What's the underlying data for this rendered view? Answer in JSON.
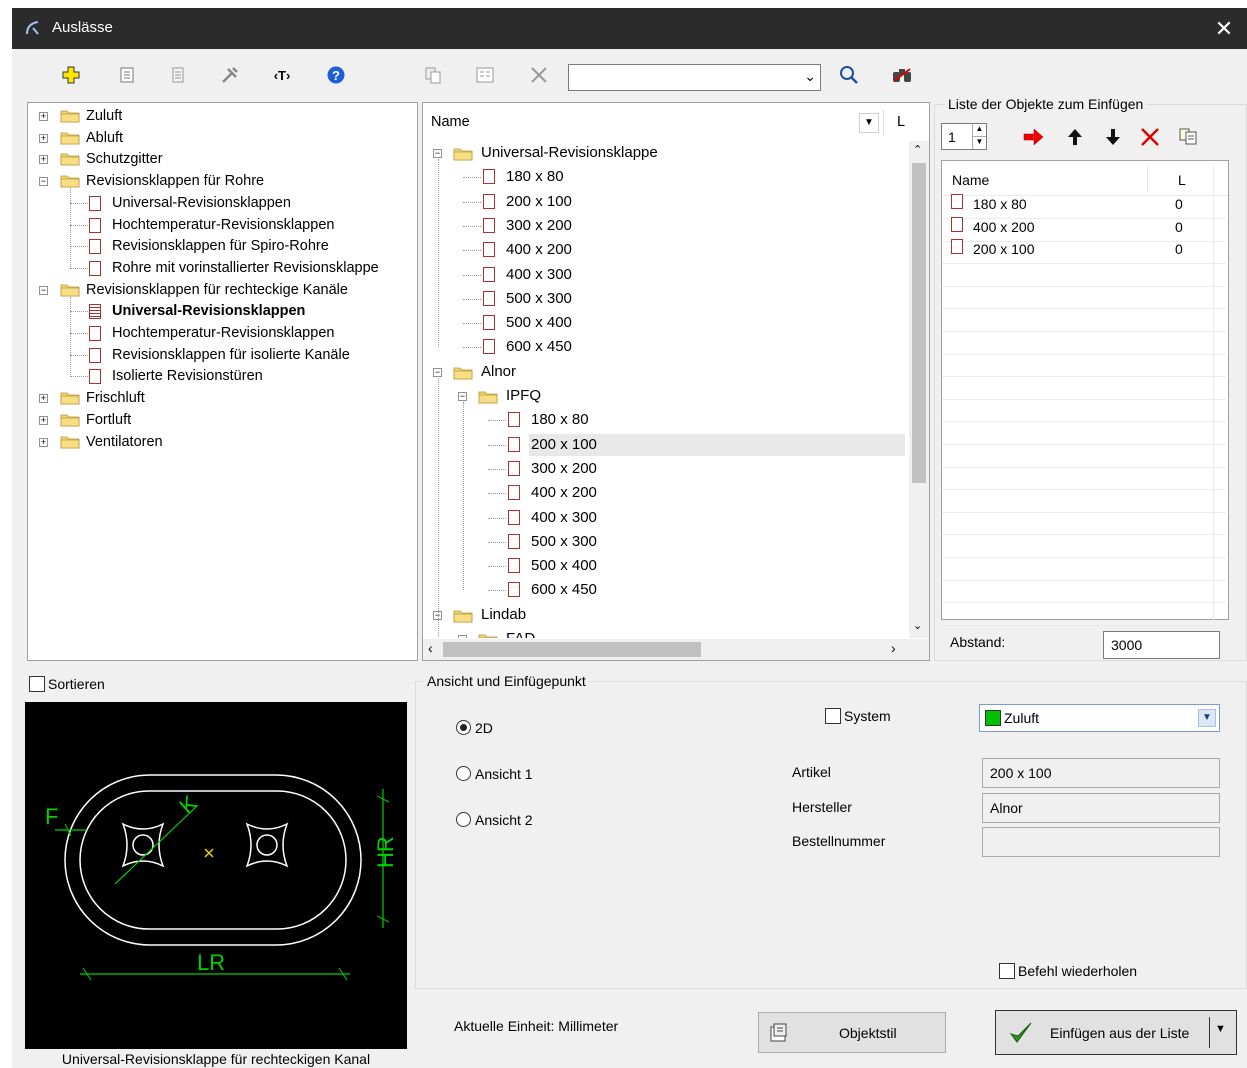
{
  "window": {
    "title": "Auslässe",
    "close": "✕"
  },
  "toolbar": {
    "search_value": "",
    "icons": [
      "add-icon",
      "properties-icon",
      "document-icon",
      "tools-icon",
      "text-tag-icon",
      "help-icon",
      "copy-icon",
      "form-icon",
      "delete-icon",
      "search-icon",
      "binoculars-icon"
    ]
  },
  "left_tree": {
    "items": [
      {
        "label": "Zuluft",
        "level": 0,
        "type": "folder",
        "expander": "+"
      },
      {
        "label": "Abluft",
        "level": 0,
        "type": "folder",
        "expander": "+"
      },
      {
        "label": "Schutzgitter",
        "level": 0,
        "type": "folder",
        "expander": "+"
      },
      {
        "label": "Revisionsklappen für Rohre",
        "level": 0,
        "type": "folder",
        "expander": "−"
      },
      {
        "label": "Universal-Revisionsklappen",
        "level": 1,
        "type": "item"
      },
      {
        "label": "Hochtemperatur-Revisionsklappen",
        "level": 1,
        "type": "item"
      },
      {
        "label": "Revisionsklappen für Spiro-Rohre",
        "level": 1,
        "type": "item"
      },
      {
        "label": "Rohre mit vorinstallierter Revisionsklappe",
        "level": 1,
        "type": "item"
      },
      {
        "label": "Revisionsklappen für rechteckige Kanäle",
        "level": 0,
        "type": "folder",
        "expander": "−"
      },
      {
        "label": "Universal-Revisionsklappen",
        "level": 1,
        "type": "item",
        "selected": true
      },
      {
        "label": "Hochtemperatur-Revisionsklappen",
        "level": 1,
        "type": "item"
      },
      {
        "label": "Revisionsklappen für isolierte Kanäle",
        "level": 1,
        "type": "item"
      },
      {
        "label": "Isolierte Revisionstüren",
        "level": 1,
        "type": "item"
      },
      {
        "label": "Frischluft",
        "level": 0,
        "type": "folder",
        "expander": "+"
      },
      {
        "label": "Fortluft",
        "level": 0,
        "type": "folder",
        "expander": "+"
      },
      {
        "label": "Ventilatoren",
        "level": 0,
        "type": "folder",
        "expander": "+"
      }
    ]
  },
  "middle_tree": {
    "col_name": "Name",
    "col_l": "L",
    "items": [
      {
        "label": "Universal-Revisionsklappe",
        "level": 0,
        "type": "folder"
      },
      {
        "label": "180 x 80",
        "level": 1,
        "type": "item"
      },
      {
        "label": "200 x 100",
        "level": 1,
        "type": "item"
      },
      {
        "label": "300 x 200",
        "level": 1,
        "type": "item"
      },
      {
        "label": "400 x 200",
        "level": 1,
        "type": "item"
      },
      {
        "label": "400 x 300",
        "level": 1,
        "type": "item"
      },
      {
        "label": "500 x 300",
        "level": 1,
        "type": "item"
      },
      {
        "label": "500 x 400",
        "level": 1,
        "type": "item"
      },
      {
        "label": "600 x 450",
        "level": 1,
        "type": "item"
      },
      {
        "label": "Alnor",
        "level": 0,
        "type": "folder"
      },
      {
        "label": "IPFQ",
        "level": 1,
        "type": "folder"
      },
      {
        "label": "180 x 80",
        "level": 2,
        "type": "item"
      },
      {
        "label": "200 x 100",
        "level": 2,
        "type": "item",
        "selected": true
      },
      {
        "label": "300 x 200",
        "level": 2,
        "type": "item"
      },
      {
        "label": "400 x 200",
        "level": 2,
        "type": "item"
      },
      {
        "label": "400 x 300",
        "level": 2,
        "type": "item"
      },
      {
        "label": "500 x 300",
        "level": 2,
        "type": "item"
      },
      {
        "label": "500 x 400",
        "level": 2,
        "type": "item"
      },
      {
        "label": "600 x 450",
        "level": 2,
        "type": "item"
      },
      {
        "label": "Lindab",
        "level": 0,
        "type": "folder"
      },
      {
        "label": "FAD",
        "level": 1,
        "type": "folder"
      }
    ]
  },
  "insert_list": {
    "group_title": "Liste der Objekte zum Einfügen",
    "count_value": "1",
    "col_name": "Name",
    "col_l": "L",
    "rows": [
      {
        "name": "180 x 80",
        "l": "0"
      },
      {
        "name": "400 x 200",
        "l": "0"
      },
      {
        "name": "200 x 100",
        "l": "0"
      }
    ],
    "abstand_label": "Abstand:",
    "abstand_value": "3000"
  },
  "sort": {
    "label": "Sortieren",
    "checked": false
  },
  "preview": {
    "caption": "Universal-Revisionsklappe für rechteckigen Kanal",
    "dim_labels": {
      "f": "F",
      "k": "K",
      "hr": "HR",
      "lr": "LR"
    }
  },
  "view_group": {
    "title": "Ansicht und Einfügepunkt",
    "radio_2d": "2D",
    "radio_view1": "Ansicht 1",
    "radio_view2": "Ansicht 2",
    "selected": "2D",
    "system_label": "System",
    "system_value": "Zuluft",
    "system_color": "#00c000",
    "artikel_label": "Artikel",
    "artikel_value": "200 x 100",
    "hersteller_label": "Hersteller",
    "hersteller_value": "Alnor",
    "bestellnummer_label": "Bestellnummer",
    "bestellnummer_value": "",
    "repeat_label": "Befehl wiederholen"
  },
  "footer": {
    "unit_text": "Aktuelle Einheit: Millimeter",
    "object_style_label": "Objektstil",
    "insert_label": "Einfügen aus der Liste"
  }
}
